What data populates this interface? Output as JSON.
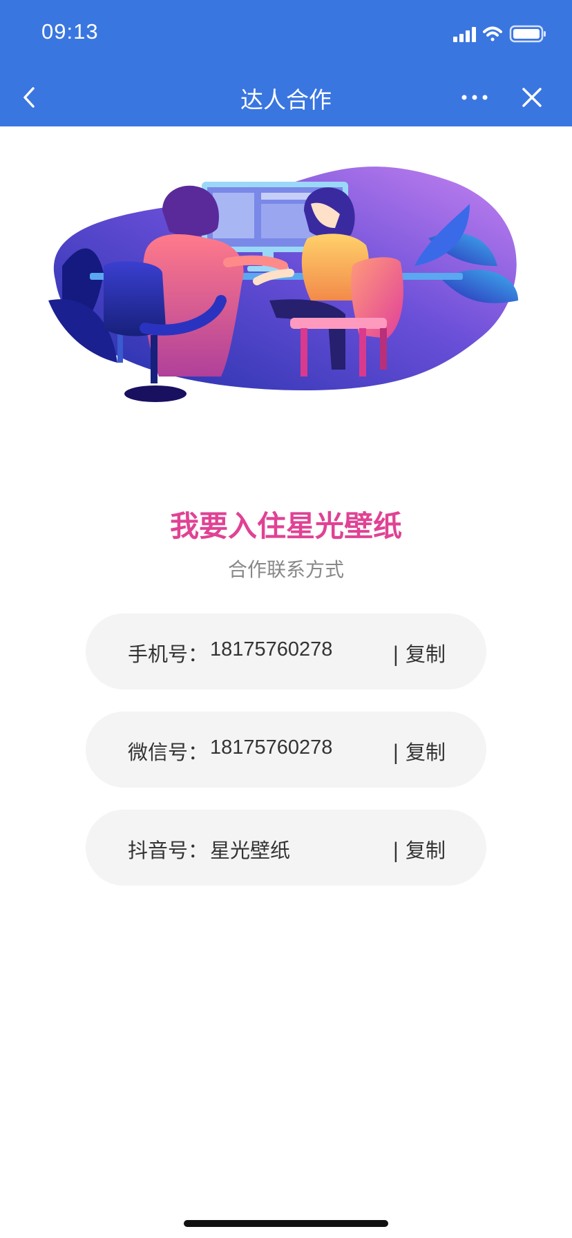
{
  "status_bar": {
    "time": "09:13"
  },
  "nav": {
    "title": "达人合作",
    "back_icon": "chevron-left-icon",
    "more_icon": "ellipsis-icon",
    "close_icon": "close-icon"
  },
  "hero": {
    "illustration": "two people working at a computer desk"
  },
  "main": {
    "title": "我要入住星光壁纸",
    "subtitle": "合作联系方式"
  },
  "contacts": [
    {
      "label": "手机号：",
      "value": "18175760278",
      "copy_label": "| 复制"
    },
    {
      "label": "微信号：",
      "value": "18175760278",
      "copy_label": "| 复制"
    },
    {
      "label": "抖音号：",
      "value": "星光壁纸",
      "copy_label": "| 复制"
    }
  ],
  "colors": {
    "header": "#3a76e0",
    "title": "#e04294",
    "card": "#f4f4f4"
  }
}
